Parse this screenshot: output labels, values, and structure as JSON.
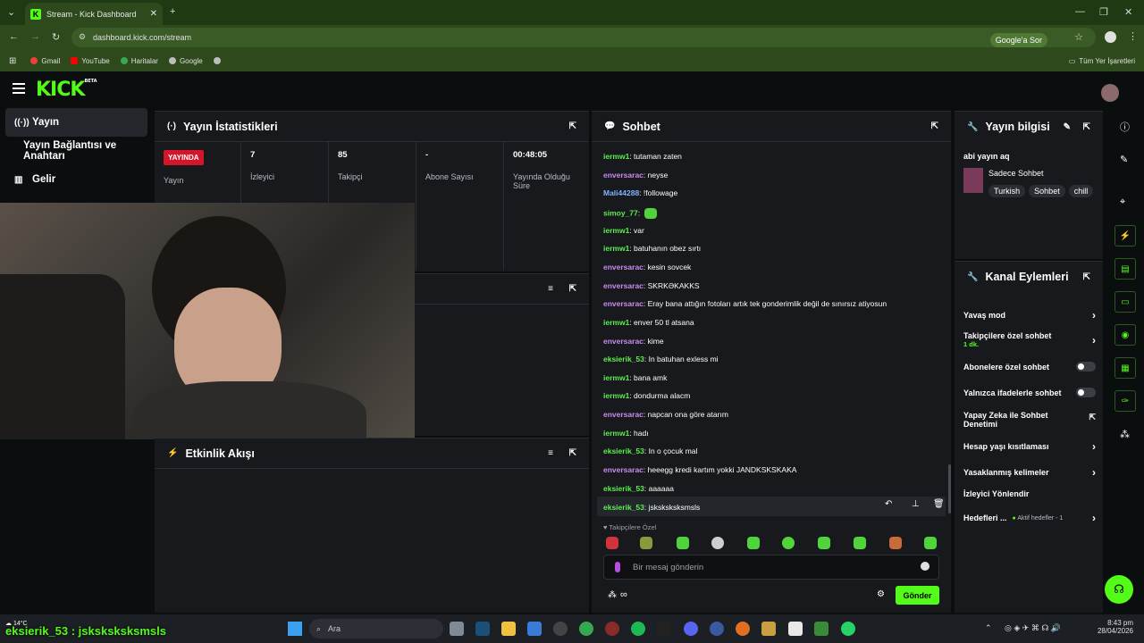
{
  "browser": {
    "tab_title": "Stream - Kick Dashboard",
    "url": "dashboard.kick.com/stream",
    "google_ask": "Google'a Sor",
    "bookmarks": [
      "Gmail",
      "YouTube",
      "Haritalar",
      "Google"
    ],
    "all_bookmarks": "Tüm Yer İşaretleri"
  },
  "kick": {
    "logo": "KICK",
    "logo_badge": "BETA",
    "accent": "#53fc18"
  },
  "sidebar": {
    "items": [
      {
        "label": "Yayın"
      },
      {
        "label": "Yayın Bağlantısı ve Anahtarı"
      },
      {
        "label": "Gelir"
      }
    ]
  },
  "stats": {
    "title": "Yayın İstatistikleri",
    "live_badge": "YAYINDA",
    "items": [
      {
        "value": "",
        "label": "Yayın"
      },
      {
        "value": "7",
        "label": "İzleyici"
      },
      {
        "value": "85",
        "label": "Takipçi"
      },
      {
        "value": "-",
        "label": "Abone Sayısı"
      },
      {
        "value": "00:48:05",
        "label": "Yayında Olduğu Süre"
      }
    ]
  },
  "activity": {
    "title": "Etkinlik Akışı"
  },
  "chat": {
    "title": "Sohbet",
    "messages": [
      {
        "user": "iermw1",
        "text": "tutaman zaten"
      },
      {
        "user": "enversarac",
        "text": "neyse"
      },
      {
        "user": "Mali44288",
        "text": "!followage"
      },
      {
        "user": "simoy_77",
        "text": ""
      },
      {
        "user": "iermw1",
        "text": "var"
      },
      {
        "user": "iermw1",
        "text": "batuhanın obez sırtı"
      },
      {
        "user": "enversarac",
        "text": "kesin sovcek"
      },
      {
        "user": "enversarac",
        "text": "SKRKƏKAKKS"
      },
      {
        "user": "enversarac",
        "text": "Eray bana attığın fotoları artık tek gonderimlik değil de sınırsız atiyosun"
      },
      {
        "user": "iermw1",
        "text": "enver 50 tl atsana"
      },
      {
        "user": "enversarac",
        "text": "kime"
      },
      {
        "user": "eksierik_53",
        "text": "In batuhan exless mi"
      },
      {
        "user": "iermw1",
        "text": "bana amk"
      },
      {
        "user": "iermw1",
        "text": "dondurma alacm"
      },
      {
        "user": "enversarac",
        "text": "napcan ona göre atarım"
      },
      {
        "user": "iermw1",
        "text": "hadı"
      },
      {
        "user": "eksierik_53",
        "text": "In o çocuk mal"
      },
      {
        "user": "enversarac",
        "text": "heeegg kredi kartım yokki JANDKSKSKAKA"
      },
      {
        "user": "eksierik_53",
        "text": "aaaaaa"
      },
      {
        "user": "eksierik_53",
        "text": "jsksksksksmsls"
      }
    ],
    "followers_only": "Takipçilere Özel",
    "input_placeholder": "Bir mesaj gönderin",
    "send_label": "Gönder"
  },
  "stream_info": {
    "title": "Yayın bilgisi",
    "stream_title": "abi yayın aq",
    "category": "Sadece Sohbet",
    "tags": [
      "Turkish",
      "Sohbet",
      "chill"
    ]
  },
  "channel_actions": {
    "title": "Kanal Eylemleri",
    "slow_mode": "Yavaş mod",
    "followers_chat": "Takipçilere özel sohbet",
    "followers_chat_value": "1 dk.",
    "subs_chat": "Abonelere özel sohbet",
    "emotes_chat": "Yalnızca ifadelerle sohbet",
    "ai_moderation": "Yapay Zeka ile Sohbet Denetimi",
    "account_age": "Hesap yaşı kısıtlaması",
    "banned_words": "Yasaklanmış kelimeler",
    "viewer_redirect": "İzleyici Yönlendir",
    "goals": "Hedefleri ...",
    "goals_value": "Aktif hedefler - 1"
  },
  "overlay": {
    "chat_line": "eksierik_53 : jsksksksksmsls",
    "weather": "14°C"
  },
  "taskbar": {
    "search_label": "Ara",
    "time": "8:43 pm",
    "date": "28/04/2026"
  }
}
